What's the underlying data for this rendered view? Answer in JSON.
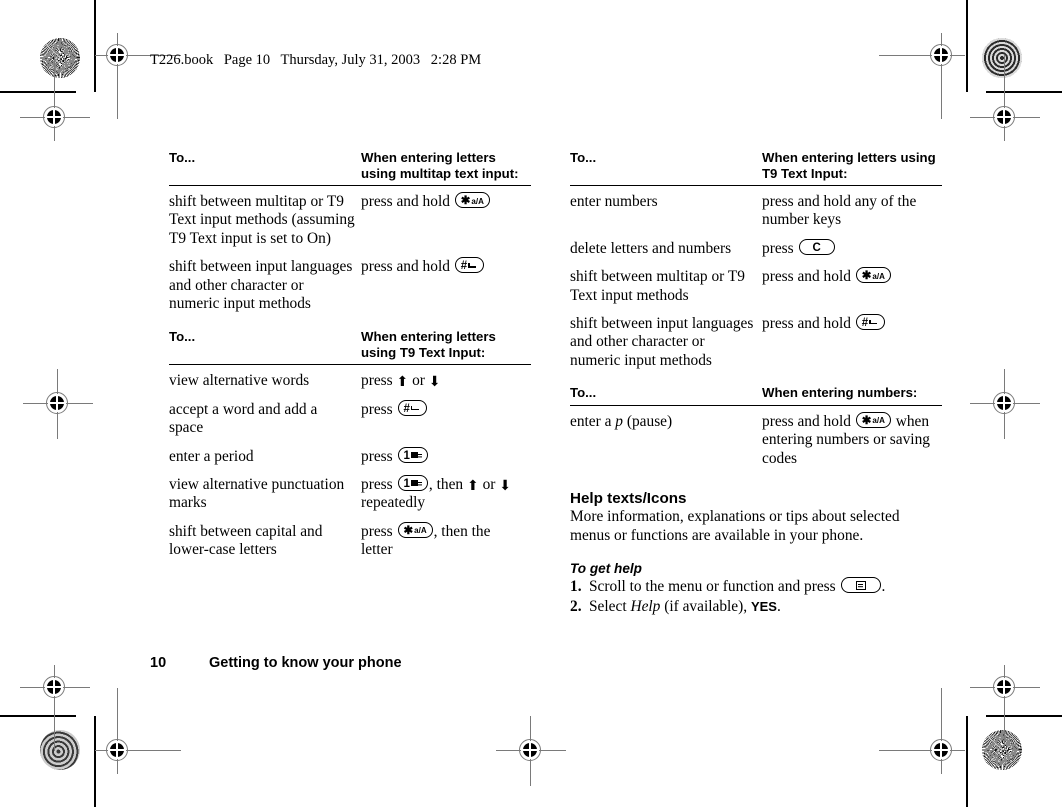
{
  "document": {
    "running_header": [
      "T226.book",
      "Page 10",
      "Thursday, July 31, 2003",
      "2:28 PM"
    ],
    "footer": {
      "page_number": "10",
      "section": "Getting to know your phone"
    }
  },
  "keys": {
    "star": {
      "main": "✳",
      "sub": "a/A",
      "name": "star-a-A-key"
    },
    "hash": {
      "main": "#",
      "sub": "",
      "name": "hash-space-key"
    },
    "clear": {
      "main": "C",
      "sub": "",
      "name": "clear-key"
    },
    "one": {
      "main": "1",
      "sub": "",
      "name": "one-voicemail-key"
    },
    "menu": {
      "main": "",
      "sub": "",
      "name": "menu-key"
    }
  },
  "tables": [
    {
      "id": "multitap-table",
      "headers": [
        "To...",
        "When entering letters using multitap text input:"
      ],
      "rows": [
        {
          "action": "shift between multitap or T9 Text input methods (assuming T9 Text input is set to On)",
          "instruction_pre": "press and hold",
          "key": "star",
          "instruction_post": ""
        },
        {
          "action": "shift between input languages and other character or numeric input methods",
          "instruction_pre": "press and hold",
          "key": "hash",
          "instruction_post": ""
        }
      ]
    },
    {
      "id": "t9-letters-table-left",
      "headers": [
        "To...",
        "When entering letters using T9 Text Input:"
      ],
      "rows": [
        {
          "action": "view alternative words",
          "instruction_pre": "press",
          "key": "arrows-up-down",
          "instruction_post": ""
        },
        {
          "action": "accept a word and add a space",
          "instruction_pre": "press",
          "key": "hash",
          "instruction_post": ""
        },
        {
          "action": "enter a period",
          "instruction_pre": "press",
          "key": "one",
          "instruction_post": ""
        },
        {
          "action": "view alternative punctuation marks",
          "instruction_pre": "press",
          "key": "one",
          "instruction_post": ", then ⬆ or ⬇ repeatedly"
        },
        {
          "action": "shift between capital and lower-case letters",
          "instruction_pre": "press",
          "key": "star",
          "instruction_post": ", then the letter"
        }
      ]
    },
    {
      "id": "t9-letters-table-right",
      "headers": [
        "To...",
        "When entering letters using T9 Text Input:"
      ],
      "rows": [
        {
          "action": "enter numbers",
          "instruction_pre": "press and hold any of the number keys",
          "key": "",
          "instruction_post": ""
        },
        {
          "action": "delete letters and numbers",
          "instruction_pre": "press",
          "key": "clear",
          "instruction_post": ""
        },
        {
          "action": "shift between multitap or T9 Text input methods",
          "instruction_pre": "press and hold",
          "key": "star",
          "instruction_post": ""
        },
        {
          "action": "shift between input languages and other character or numeric input methods",
          "instruction_pre": "press and hold",
          "key": "hash",
          "instruction_post": ""
        }
      ]
    },
    {
      "id": "numbers-table",
      "headers": [
        "To...",
        "When entering numbers:"
      ],
      "rows": [
        {
          "action": "enter a p (pause)",
          "action_italic_part": "p",
          "instruction_pre": "press and hold",
          "key": "star",
          "instruction_post": " when entering numbers or saving codes"
        }
      ]
    }
  ],
  "help_section": {
    "heading": "Help texts/Icons",
    "body": "More information, explanations or tips about selected menus or functions are available in your phone.",
    "subheading": "To get help",
    "steps": [
      {
        "num": "1.",
        "text_pre": "Scroll to the menu or function and press",
        "key": "menu",
        "text_post": "."
      },
      {
        "num": "2.",
        "text_pre": "Select ",
        "italic": "Help",
        "text_mid": " (if available), ",
        "bold": "YES",
        "text_post": "."
      }
    ]
  },
  "colors": {
    "text": "#000000",
    "page_background": "#ffffff",
    "rule": "#000000",
    "registration_mark": "#7a7a7a"
  }
}
